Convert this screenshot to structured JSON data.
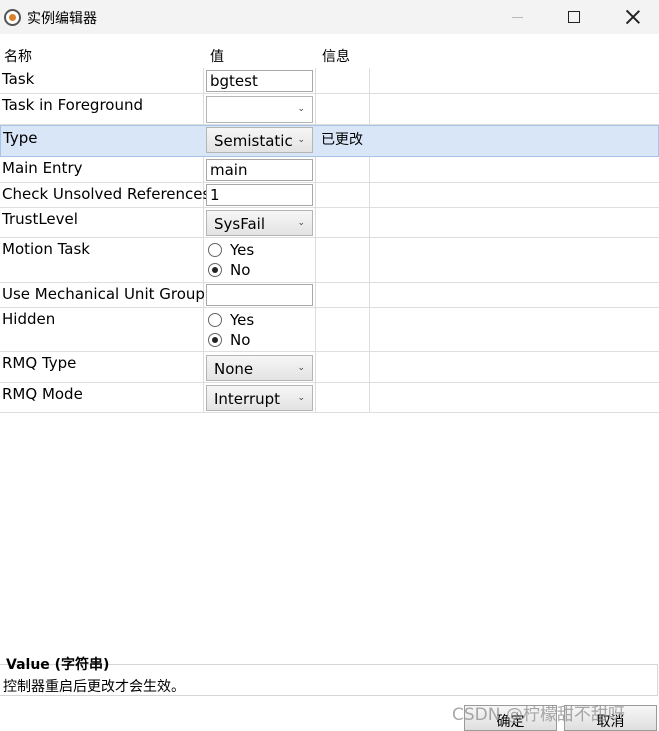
{
  "window": {
    "title": "实例编辑器",
    "icons": {
      "app": "robot-app-icon",
      "minimize": "minimize-icon",
      "maximize": "maximize-icon",
      "close": "close-icon"
    }
  },
  "grid": {
    "headers": {
      "name": "名称",
      "value": "值",
      "info": "信息"
    },
    "rows": {
      "task": {
        "label": "Task",
        "value": "bgtest"
      },
      "task_fg": {
        "label": "Task in Foreground",
        "value": ""
      },
      "type": {
        "label": "Type",
        "value": "Semistatic",
        "info": "已更改"
      },
      "main_entry": {
        "label": "Main Entry",
        "value": "main"
      },
      "check_unsolved": {
        "label": "Check Unsolved References",
        "value": "1"
      },
      "trust_level": {
        "label": "TrustLevel",
        "value": "SysFail"
      },
      "motion_task": {
        "label": "Motion Task",
        "options": [
          "Yes",
          "No"
        ],
        "selected": "No"
      },
      "mech_unit_group": {
        "label": "Use Mechanical Unit Group",
        "value": ""
      },
      "hidden": {
        "label": "Hidden",
        "options": [
          "Yes",
          "No"
        ],
        "selected": "No"
      },
      "rmq_type": {
        "label": "RMQ Type",
        "value": "None"
      },
      "rmq_mode": {
        "label": "RMQ Mode",
        "value": "Interrupt"
      }
    }
  },
  "description": {
    "title": "Value (字符串)",
    "text": "控制器重启后更改才会生效。"
  },
  "buttons": {
    "ok": "确定",
    "cancel": "取消"
  },
  "watermark": "CSDN @柠檬甜不甜呀",
  "colors": {
    "selected_row": "#d8e6f7",
    "titlebar": "#f3f3f3"
  }
}
